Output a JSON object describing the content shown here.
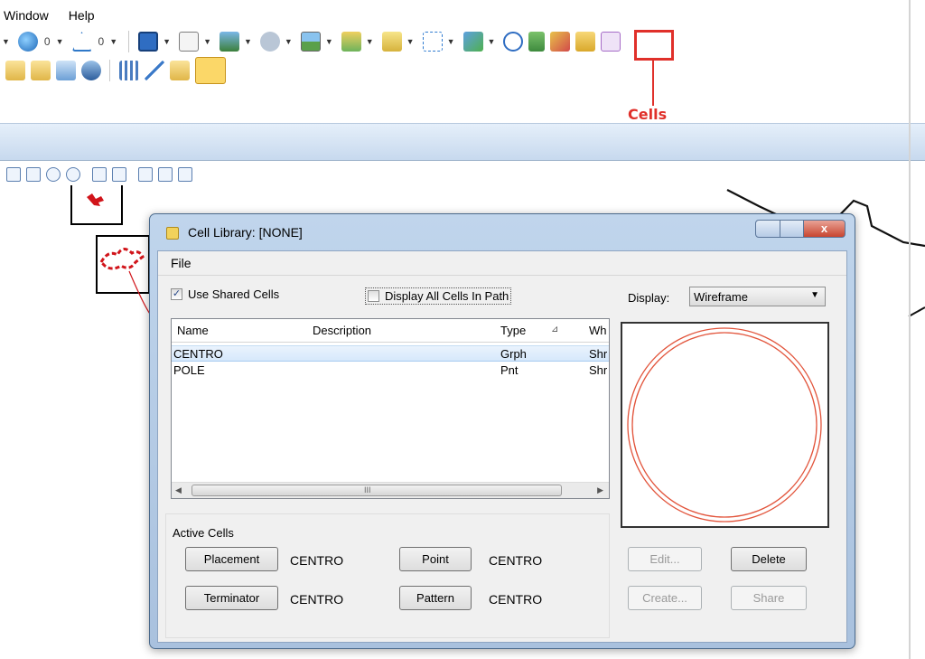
{
  "menubar": {
    "items": [
      "Window",
      "Help"
    ]
  },
  "toolbar": {
    "num_a": "0",
    "num_b": "0",
    "cells_label": "Cells",
    "icons": [
      "view-icon",
      "globe-icon",
      "triangle-icon",
      "square-icon",
      "page-icon",
      "cells-icon"
    ]
  },
  "dialog": {
    "title": "Cell Library: [NONE]",
    "close_label": "x",
    "menu_file": "File",
    "use_shared_cells": {
      "label": "Use Shared Cells",
      "checked": true
    },
    "display_all_cells": {
      "label": "Display All Cells In Path",
      "checked": false
    },
    "display": {
      "label": "Display:",
      "value": "Wireframe"
    },
    "list": {
      "columns": [
        "Name",
        "Description",
        "Type",
        "Wh"
      ],
      "rows": [
        {
          "name": "CENTRO",
          "description": "",
          "type": "Grph",
          "where": "Shr"
        },
        {
          "name": "POLE",
          "description": "",
          "type": "Pnt",
          "where": "Shr"
        }
      ],
      "scroll_grip": "III"
    },
    "active_cells": {
      "label": "Active Cells",
      "placement": {
        "label": "Placement",
        "value": "CENTRO"
      },
      "terminator": {
        "label": "Terminator",
        "value": "CENTRO"
      },
      "point": {
        "label": "Point",
        "value": "CENTRO"
      },
      "pattern": {
        "label": "Pattern",
        "value": "CENTRO"
      }
    },
    "buttons": {
      "edit": "Edit...",
      "delete": "Delete",
      "create": "Create...",
      "share": "Share"
    }
  },
  "colors": {
    "highlight": "#e0302a",
    "preview_circle": "#e2543b",
    "dialog_frame": "#a9c1de"
  }
}
